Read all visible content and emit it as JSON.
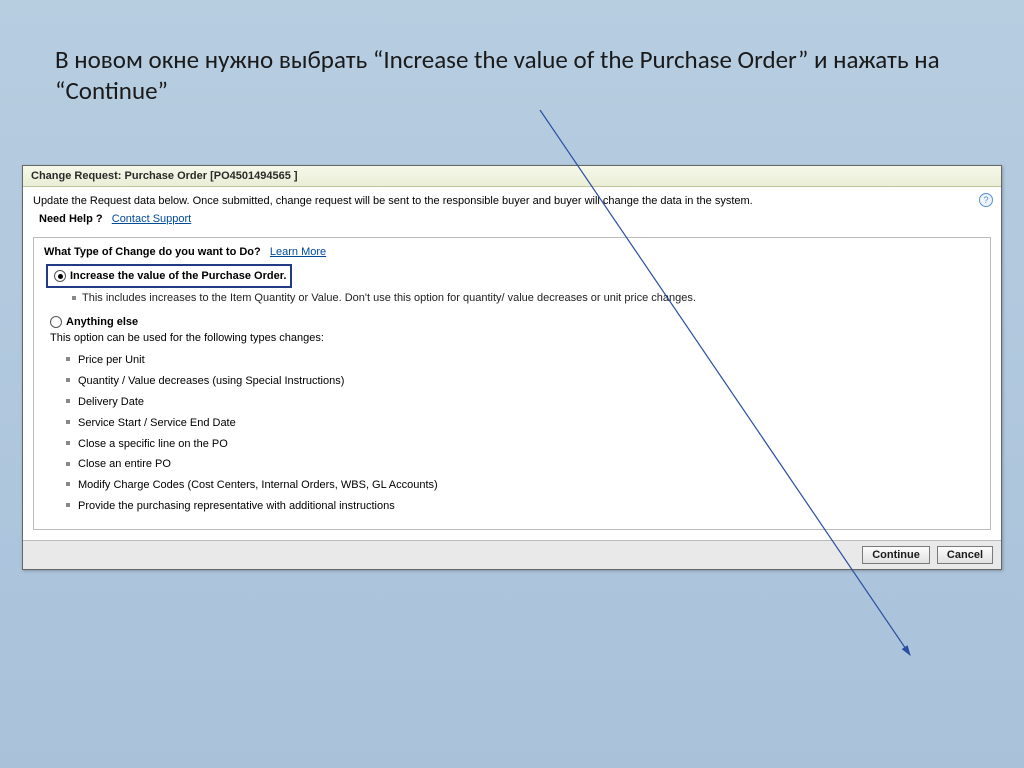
{
  "slide": {
    "title": "В новом окне нужно выбрать “Increase the value of the Purchase Order” и нажать на “Continue”"
  },
  "panel": {
    "header": "Change Request: Purchase Order [PO4501494565 ]",
    "info_text": "Update the Request data below. Once submitted, change request will be sent to the responsible  buyer and buyer will change the data in the system.",
    "need_help_label": "Need Help ?",
    "contact_support": "Contact Support",
    "question": "What Type of Change do you want to Do?",
    "learn_more": "Learn More",
    "option1_label": "Increase the value of the Purchase Order.",
    "option1_note": "This includes increases to the Item Quantity or Value. Don't use this option for quantity/ value decreases or unit price changes.",
    "option2_label": "Anything else",
    "option2_explain": "This option can be used for the following types changes:",
    "change_types": [
      "Price per Unit",
      "Quantity / Value decreases (using Special Instructions)",
      "Delivery Date",
      "Service Start / Service End Date",
      "Close a specific line on the PO",
      "Close an entire PO",
      "Modify Charge Codes (Cost Centers, Internal Orders, WBS, GL Accounts)",
      "Provide the purchasing representative with additional instructions"
    ]
  },
  "buttons": {
    "continue": "Continue",
    "cancel": "Cancel"
  },
  "help_glyph": "?"
}
